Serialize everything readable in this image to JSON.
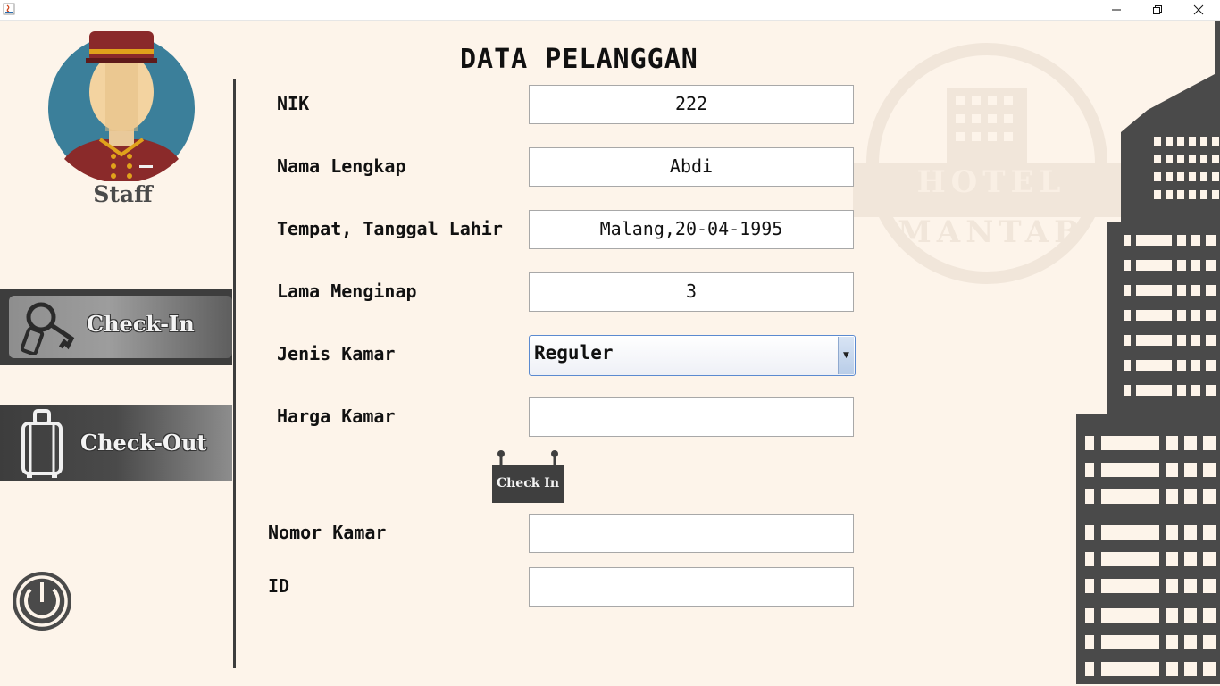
{
  "window": {
    "minimize_icon": "minimize-icon",
    "restore_icon": "restore-icon",
    "close_icon": "close-icon"
  },
  "sidebar": {
    "staff_label": "Staff",
    "checkin_label": "Check-In",
    "checkout_label": "Check-Out"
  },
  "form": {
    "title": "DATA PELANGGAN",
    "nik_label": "NIK",
    "nik_value": "222",
    "nama_label": "Nama Lengkap",
    "nama_value": "Abdi",
    "ttl_label": "Tempat, Tanggal Lahir",
    "ttl_value": "Malang,20-04-1995",
    "lama_label": "Lama Menginap",
    "lama_value": "3",
    "jenis_label": "Jenis Kamar",
    "jenis_value": "Reguler",
    "harga_label": "Harga Kamar",
    "harga_value": "",
    "checkin_button": "Check In",
    "nomor_label": "Nomor Kamar",
    "nomor_value": "",
    "id_label": "ID",
    "id_value": ""
  },
  "logo": {
    "line1": "HOTEL",
    "line2": "MANTAB"
  },
  "colors": {
    "background": "#fdf4ea",
    "dark": "#3d3d3d",
    "accent": "#5b8ad0"
  }
}
